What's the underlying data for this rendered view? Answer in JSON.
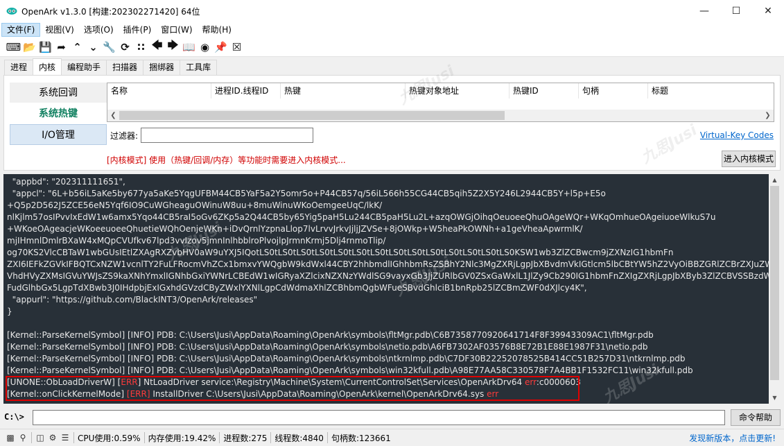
{
  "window": {
    "title": "OpenArk v1.3.0 [构建:202302271420]  64位",
    "min_icon": "minimize-icon",
    "max_icon": "maximize-icon",
    "close_icon": "close-icon"
  },
  "menu": [
    {
      "label": "文件(F)",
      "active": true
    },
    {
      "label": "视图(V)"
    },
    {
      "label": "选项(O)"
    },
    {
      "label": "插件(P)"
    },
    {
      "label": "窗口(W)"
    },
    {
      "label": "帮助(H)"
    }
  ],
  "toolbar_icons": [
    "console-icon",
    "open-folder-icon",
    "save-icon",
    "export-icon",
    "arrow-up-icon",
    "arrow-down-icon",
    "wrench-icon",
    "refresh-icon",
    "grid-icon",
    "arrow-left-icon",
    "arrow-right-icon",
    "book-icon",
    "record-icon",
    "pin-icon",
    "close-box-icon"
  ],
  "tabs": [
    {
      "label": "进程"
    },
    {
      "label": "内核",
      "active": true
    },
    {
      "label": "编程助手"
    },
    {
      "label": "扫描器"
    },
    {
      "label": "捆绑器"
    },
    {
      "label": "工具库"
    }
  ],
  "kernel": {
    "nav": [
      {
        "label": "系统回调"
      },
      {
        "label": "系统热键",
        "selected": true
      },
      {
        "label": "I/O管理",
        "hover": true
      }
    ],
    "columns": [
      "名称",
      "进程ID.线程ID",
      "热键",
      "热键对象地址",
      "热键ID",
      "句柄",
      "标题"
    ],
    "filter_label": "过滤器:",
    "filter_value": "",
    "vk_link": "Virtual-Key Codes",
    "warning": "[内核模式] 使用（热键/回调/内存）等功能时需要进入内核模式...",
    "enter_button": "进入内核模式"
  },
  "console": {
    "lines": [
      {
        "text": "  \"appbd\": \"202311111651\","
      },
      {
        "text": "  \"appcl\": \"6L+b56iL5aKe5by677ya5aKe5YqgUFBM44CB5YaF5a2Y5omr5o+P44CB57q/56iL566h55CG44CB5qih5Z2X5Y246L2944CB5Y+l5p+E5o"
      },
      {
        "text": "+Q5p2D562J5ZCE56eN5Yqf6IO9CuWGheaguOWinuW8uu+8muWinuWKoOemgeeUqC/lkK/"
      },
      {
        "text": "nlKjlm57osIPvvIxEdW1w6amx5Yqo44CB5raI5oGv6ZKp5a2Q44CB5by65Yig5paH5Lu244CB5paH5Lu2L+azqOWGjOihqOeuoeeQhuOAgeWQr+WKqOmhueOAgeiuoeWlkuS7u"
      },
      {
        "text": "+WKoeOAgeacjeWKoeeuoeeQhuetieWQhOenjeWKn+iDvQrnlYzpnaLlop7lvLrvvJrkvJjljJZVSe+8jOWkp+W5heaPkOWNh+a1geVheaApwrmlK/"
      },
      {
        "text": "mjIHmnlDmlrBXaW4xMQpCVUfkv67lpd3vvIzov5jmnInlhbblroPlvojlpJrmnKrmj5Dlj4rnmoTlip/"
      },
      {
        "text": "og70KS2VlcCBTaW1wbGUsIEtlZXAgRXZvbHV0aW9uYXJ5IQotLS0tLS0tLS0tLS0tLS0tLS0tLS0tLS0tLS0tLS0tLS0tLS0tLS0tLS0KSW1wb3ZlZCBwcm9jZXNzIG1hbmFn"
      },
      {
        "text": "ZXI6IEFkZGVkIFBQTCxNZW1vcnlTY2FuLFRocmVhZCx1bmxvYWQgbW9kdWxl44CBY2hhbmdlIGhhbmRsZSBhY2Nlc3MgZXRjLgpJbXBvdmVkIGtlcm5lbCBtYW5hZ2VyOiBBZGRlZCBrZXJuZWwgZm"
      },
      {
        "text": "VhdHVyZXMsIGVuYWJsZS9kaXNhYmxlIGNhbGxiYWNrLCBEdW1wIGRyaXZlcixNZXNzYWdlSG9vayxGb3JjZURlbGV0ZSxGaWxlL1JlZy9Cb290IG1hbmFnZXIgZXRjLgpJbXByb3ZlZCBVSSBzdWJzdG"
      },
      {
        "text": "FudGlhbGx5LgpTdXBwb3J0IHdpbjExIGxhdGVzdCByZWxlYXNlLgpCdWdmaXhlZCBhbmQgbWFueSBvdGhlciB1bnRpb25lZCBmZWF0dXJlcy4K\","
      },
      {
        "text": "  \"appurl\": \"https://github.com/BlackINT3/OpenArk/releases\""
      },
      {
        "text": "}"
      },
      {
        "text": ""
      },
      {
        "text": "[Kernel::ParseKernelSymbol] [INFO] PDB: C:\\Users\\Jusi\\AppData\\Roaming\\OpenArk\\symbols\\fltMgr.pdb\\C6B7358770920641714F8F39943309AC1\\fltMgr.pdb"
      },
      {
        "text": "[Kernel::ParseKernelSymbol] [INFO] PDB: C:\\Users\\Jusi\\AppData\\Roaming\\OpenArk\\symbols\\netio.pdb\\A6FB7302AF03576B8E72B1E88E1987F31\\netio.pdb"
      },
      {
        "text": "[Kernel::ParseKernelSymbol] [INFO] PDB: C:\\Users\\Jusi\\AppData\\Roaming\\OpenArk\\symbols\\ntkrnlmp.pdb\\C7DF30B22252078525B414CC51B257D31\\ntkrnlmp.pdb"
      },
      {
        "text": "[Kernel::ParseKernelSymbol] [INFO] PDB: C:\\Users\\Jusi\\AppData\\Roaming\\OpenArk\\symbols\\win32kfull.pdb\\A98E77AA58C330578F7A4BB1F1532FC11\\win32kfull.pdb"
      }
    ],
    "err_line1": {
      "pre": "[UNONE::ObLoadDriverW] [",
      "err": "ERR",
      "mid": "] NtLoadDriver service:\\Registry\\Machine\\System\\CurrentControlSet\\Services\\OpenArkDrv64 ",
      "err2": "err",
      "post": ":c0000603"
    },
    "err_line2": {
      "pre": "[Kernel::onClickKernelMode] ",
      "err": "[ERR]",
      "mid": " InstallDriver C:\\Users\\Jusi\\AppData\\Roaming\\OpenArk\\kernel\\OpenArkDrv64.sys ",
      "err2": "err"
    }
  },
  "cmd": {
    "prompt": "C:\\>",
    "value": "",
    "help_button": "命令帮助"
  },
  "status": {
    "cpu": "CPU使用:0.59%",
    "mem": "内存使用:19.42%",
    "procs": "进程数:275",
    "threads": "线程数:4840",
    "handles": "句柄数:123661",
    "update": "发现新版本，点击更新!"
  },
  "watermark": "九思Jusi",
  "colors": {
    "console_bg": "#283038",
    "err": "#ff3b3b",
    "link": "#0066cc",
    "selected_nav": "#108060"
  }
}
